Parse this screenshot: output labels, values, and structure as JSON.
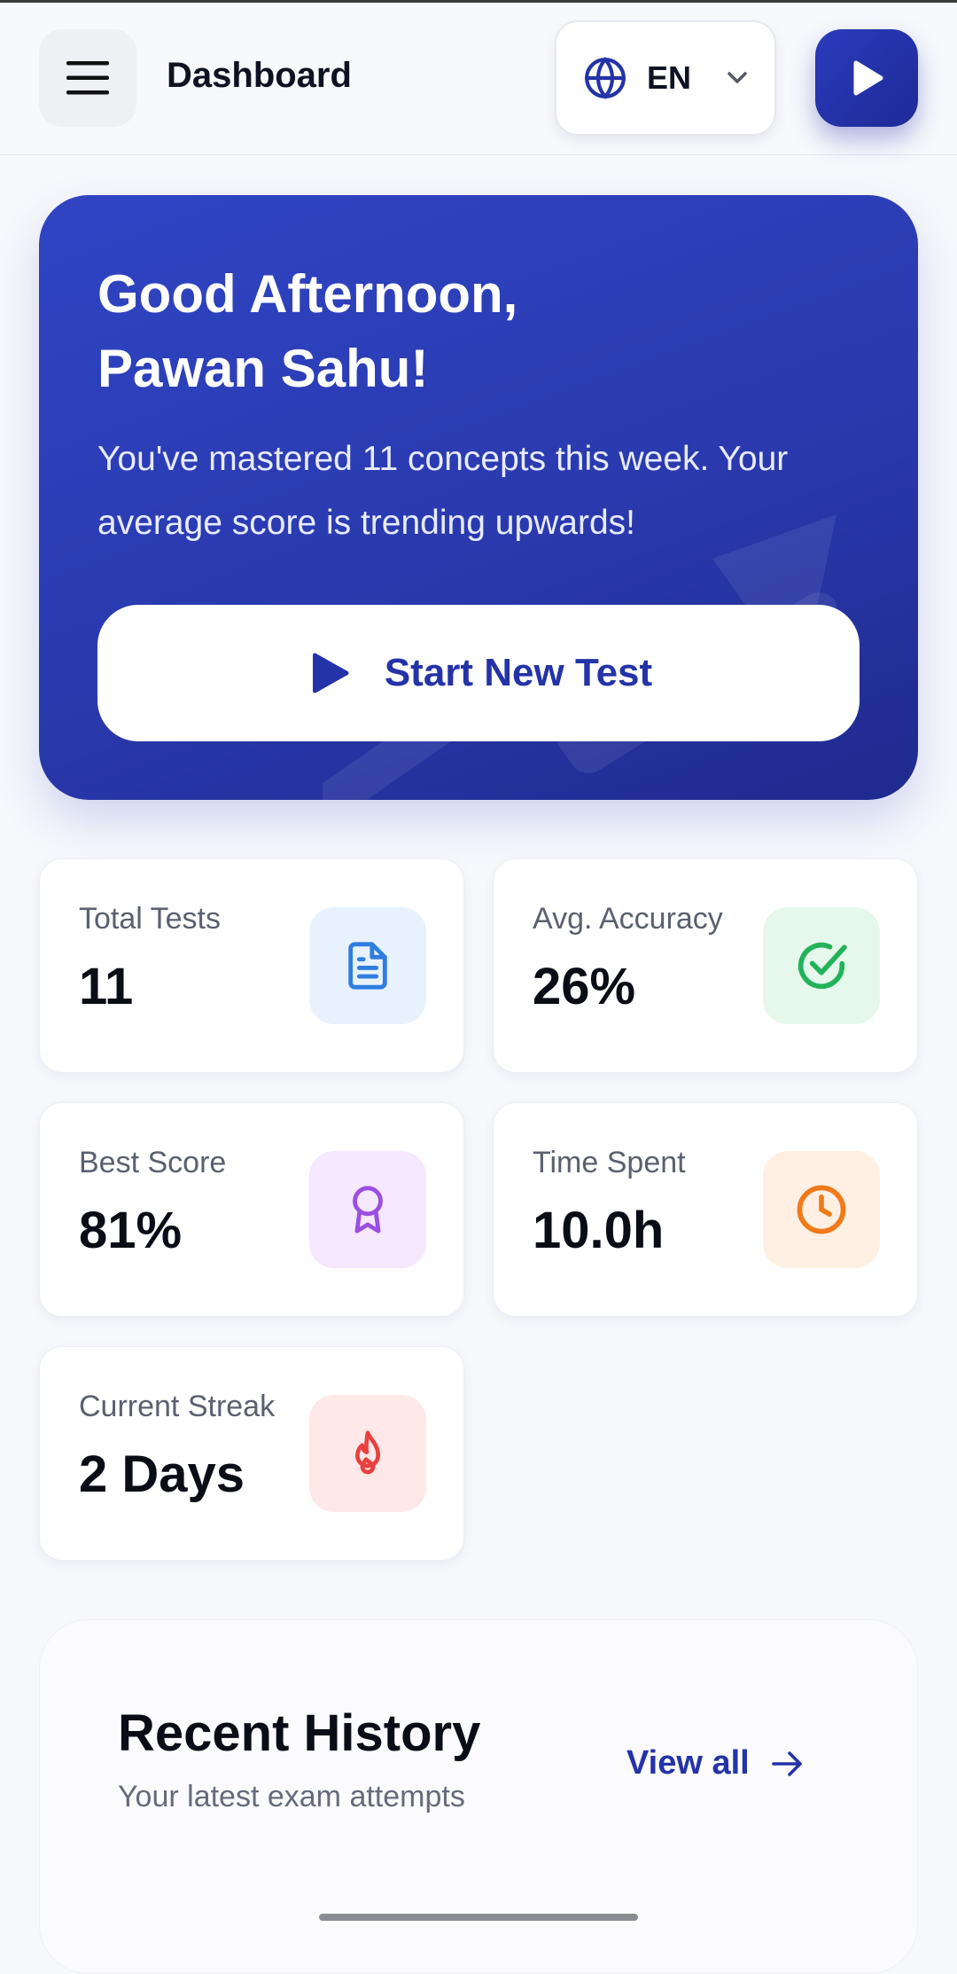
{
  "header": {
    "title": "Dashboard",
    "language": "EN"
  },
  "hero": {
    "greeting_line1": "Good Afternoon,",
    "greeting_line2": "Pawan Sahu!",
    "message": "You've mastered 11 concepts this week. Your average score is trending upwards!",
    "cta_label": "Start New Test"
  },
  "stats": {
    "total_tests": {
      "label": "Total Tests",
      "value": "11",
      "icon": "document-icon",
      "color": "#2f7de1"
    },
    "avg_accuracy": {
      "label": "Avg. Accuracy",
      "value": "26%",
      "icon": "check-circle-icon",
      "color": "#22b35a"
    },
    "best_score": {
      "label": "Best Score",
      "value": "81%",
      "icon": "award-icon",
      "color": "#9b4fe0"
    },
    "time_spent": {
      "label": "Time Spent",
      "value": "10.0h",
      "icon": "clock-icon",
      "color": "#f07a1a"
    },
    "current_streak": {
      "label": "Current Streak",
      "value": "2 Days",
      "icon": "flame-icon",
      "color": "#e8413e"
    }
  },
  "history": {
    "title": "Recent History",
    "subtitle": "Your latest exam attempts",
    "view_all_label": "View all"
  },
  "colors": {
    "primary": "#2433a8",
    "background": "#f7f8fc"
  }
}
